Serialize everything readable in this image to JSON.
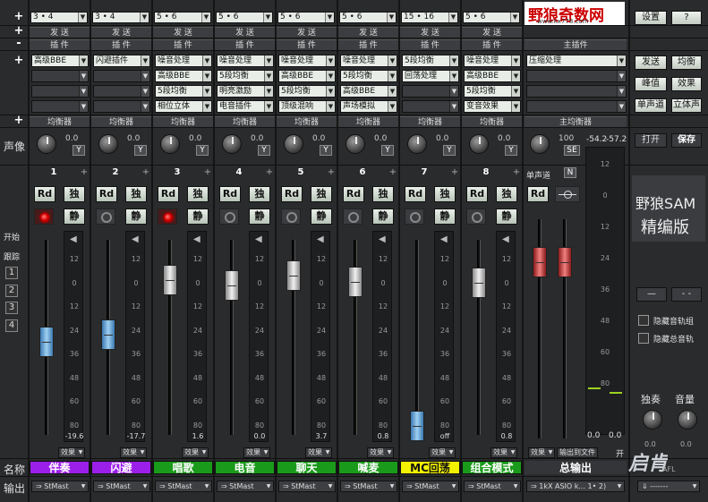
{
  "left_labels": {
    "pan": "声像",
    "start": "开始",
    "track": "跟踪",
    "track_nums": [
      "1",
      "2",
      "3",
      "4"
    ],
    "name": "名称",
    "output": "输出"
  },
  "row_buttons": {
    "plus": "+",
    "minus": "-"
  },
  "send_label": "发 送",
  "plugin_label": "插 件",
  "eq_label": "均衡器",
  "solo_label": "独",
  "mute_label": "静",
  "rd_label": "Rd",
  "y_label": "Y",
  "effects_label": "效果",
  "meter_ticks": [
    "12",
    "0",
    "12",
    "24",
    "36",
    "48",
    "60",
    "80"
  ],
  "channels": [
    {
      "num": "1",
      "combo": "3 • 4",
      "pan": "0.0",
      "slots": [
        "高级BBE",
        "",
        "",
        ""
      ],
      "led_on": true,
      "level": "-19.6",
      "name": "伴奏",
      "name_color": "#9b1fe8",
      "output": "StMast"
    },
    {
      "num": "2",
      "combo": "3 • 4",
      "pan": "0.0",
      "slots": [
        "闪避插件",
        "",
        "",
        ""
      ],
      "led_on": false,
      "level": "-17.7",
      "name": "闪避",
      "name_color": "#9b1fe8",
      "output": "StMast"
    },
    {
      "num": "3",
      "combo": "5 • 6",
      "pan": "0.0",
      "slots": [
        "噪音处理",
        "高级BBE",
        "5段均衡",
        "相位立体"
      ],
      "led_on": true,
      "level": "1.6",
      "name": "唱歌",
      "name_color": "#1a9a1a",
      "output": "StMast"
    },
    {
      "num": "4",
      "combo": "5 • 6",
      "pan": "0.0",
      "slots": [
        "噪音处理",
        "5段均衡",
        "明亮激励",
        "电音插件"
      ],
      "led_on": false,
      "level": "0.0",
      "name": "电音",
      "name_color": "#1a9a1a",
      "output": "StMast"
    },
    {
      "num": "5",
      "combo": "5 • 6",
      "pan": "0.0",
      "slots": [
        "噪音处理",
        "高级BBE",
        "5段均衡",
        "顶级混响"
      ],
      "led_on": false,
      "level": "3.7",
      "name": "聊天",
      "name_color": "#1a9a1a",
      "output": "StMast"
    },
    {
      "num": "6",
      "combo": "5 • 6",
      "pan": "0.0",
      "slots": [
        "噪音处理",
        "5段均衡",
        "高级BBE",
        "声场模拟"
      ],
      "led_on": false,
      "level": "0.8",
      "name": "喊麦",
      "name_color": "#1a9a1a",
      "output": "StMast"
    },
    {
      "num": "7",
      "combo": "15 • 16",
      "pan": "0.0",
      "slots": [
        "5段均衡",
        "回荡处理",
        "",
        ""
      ],
      "led_on": false,
      "level": "off",
      "name": "MC回荡",
      "name_color": "#f2f200",
      "output": "StMast"
    },
    {
      "num": "8",
      "combo": "5 • 6",
      "pan": "0.0",
      "slots": [
        "噪音处理",
        "高级BBE",
        "5段均衡",
        "变音效果"
      ],
      "led_on": false,
      "level": "0.8",
      "name": "组合模式",
      "name_color": "#1a9a1a",
      "output": "StMast"
    }
  ],
  "master": {
    "logo": "野狼奇数网",
    "logo_url": "www.kx778.com",
    "plugin_label": "主插件",
    "slot": "压缩处理",
    "eq_label": "主均衡器",
    "pan": "100",
    "se_label": "SE",
    "mono_label": "单声道",
    "n_label": "N",
    "meter_vals": [
      "-54.2",
      "-57.2"
    ],
    "meter_ticks": [
      "12",
      "0",
      "12",
      "24",
      "36",
      "48",
      "60",
      "80"
    ],
    "bottom_vals": [
      "0.0",
      "0.0"
    ],
    "effects_label": "效果",
    "output_file_label": "输出到文件",
    "out_partial": "开",
    "name": "总输出",
    "output": "1kX ASIO k... 1• 2)"
  },
  "right_panel": {
    "settings": "设置",
    "help": "?",
    "send": "发送",
    "eq": "均衡",
    "peak": "峰值",
    "effect": "效果",
    "mono": "单声道",
    "stereo": "立体声",
    "open": "打开",
    "save": "保存",
    "title1": "野狼SAM",
    "title2": "精编版",
    "dash1": "—",
    "dash2": "- -",
    "hide_group": "隐藏音轨组",
    "hide_bus": "隐藏总音轨",
    "solo": "独奏",
    "volume": "音量",
    "solo_val": "0.0",
    "vol_val": "0.0",
    "brand": "启肯",
    "afl": "AFL",
    "out_dash": "-------"
  }
}
